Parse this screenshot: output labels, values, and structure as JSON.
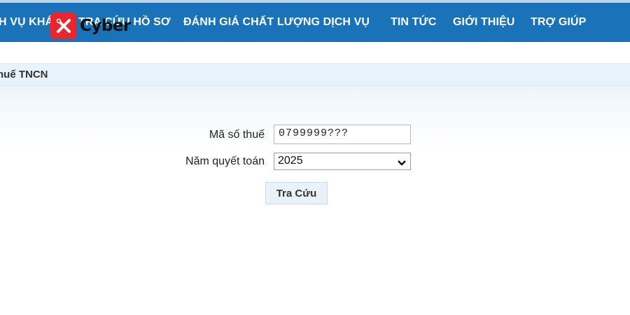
{
  "nav": {
    "items": [
      "H VỤ KHÁ",
      "TRA CỨU HỒ SƠ",
      "ĐÁNH GIÁ CHẤT LƯỢNG DỊCH VỤ",
      "TIN TỨC",
      "GIỚI THIỆU",
      "TRỢ GIÚP"
    ],
    "logo_text": "Cyber",
    "logo_icon": "cross-tools-icon"
  },
  "page": {
    "title": "huế TNCN"
  },
  "form": {
    "tax_code_label": "Mã số thuế",
    "tax_code_value": "0799999???",
    "year_label": "Năm quyết toán",
    "year_value": "2025",
    "submit_label": "Tra Cứu"
  },
  "colors": {
    "nav_bg": "#1a73b8",
    "logo_red": "#e8262d",
    "title_bg": "#e7f2fa",
    "button_bg": "#e8f2fa"
  }
}
